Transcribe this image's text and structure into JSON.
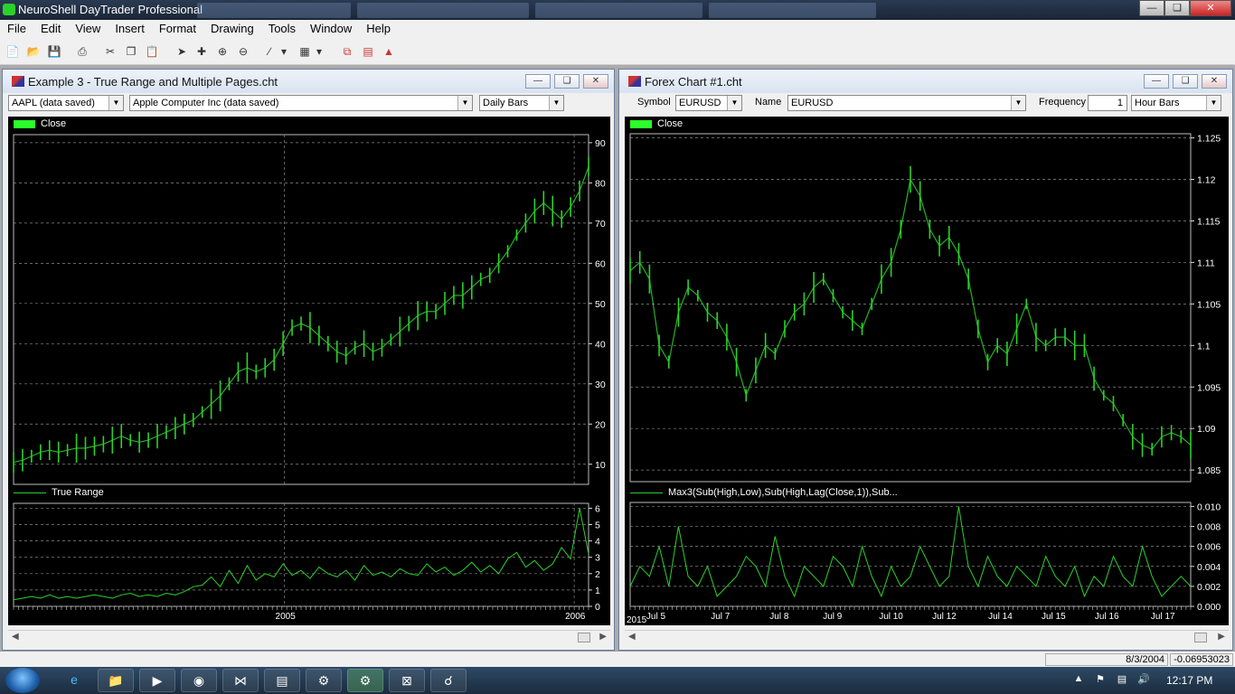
{
  "app": {
    "title": "NeuroShell DayTrader Professional"
  },
  "menu": [
    "File",
    "Edit",
    "View",
    "Insert",
    "Format",
    "Drawing",
    "Tools",
    "Window",
    "Help"
  ],
  "toolbar_icons": [
    "new-icon",
    "open-icon",
    "save-icon",
    "print-icon",
    "cut-icon",
    "copy-icon",
    "paste-icon",
    "pointer-icon",
    "crosshair-icon",
    "zoom-in-icon",
    "zoom-out-icon",
    "line-tool-icon",
    "fill-tool-icon",
    "cascade-windows-icon",
    "tile-windows-icon",
    "indicator-icon"
  ],
  "left": {
    "title": "Example 3 - True Range and Multiple Pages.cht",
    "symbol": "AAPL (data saved)",
    "name": "Apple Computer Inc (data saved)",
    "frequency": "Daily Bars",
    "legend_top": "Close",
    "legend_bottom": "True Range"
  },
  "right": {
    "title": "Forex Chart #1.cht",
    "symbol_label": "Symbol",
    "symbol": "EURUSD",
    "name_label": "Name",
    "name": "EURUSD",
    "frequency_label": "Frequency",
    "frequency_value": "1",
    "frequency": "Hour Bars",
    "legend_top": "Close",
    "legend_bottom": "Max3(Sub(High,Low),Sub(High,Lag(Close,1)),Sub..."
  },
  "status": {
    "date": "8/3/2004",
    "value": "-0.06953023"
  },
  "clock": "12:17 PM",
  "colors": {
    "series": "#2bd12b",
    "plot_bg": "#000000",
    "grid": "#8a8a8a"
  },
  "chart_data": [
    {
      "type": "bar",
      "title": "AAPL Close",
      "legend": "Close",
      "ylim": [
        5,
        92
      ],
      "yticks": [
        10,
        20,
        30,
        40,
        50,
        60,
        70,
        80,
        90
      ],
      "xticks": [
        "2005",
        "2006"
      ],
      "x": [
        0,
        10,
        20,
        30,
        40,
        50,
        60,
        70,
        80,
        90,
        100,
        110,
        120,
        130,
        140,
        150,
        160,
        170,
        180,
        190,
        200,
        210,
        220,
        230,
        240,
        250,
        260,
        270,
        280,
        290,
        300,
        310,
        320,
        330,
        340,
        350,
        360,
        370,
        380,
        390,
        400,
        410,
        420,
        430,
        440,
        450,
        460,
        470,
        480,
        490,
        500,
        510,
        520,
        530,
        540,
        550,
        560,
        570,
        580,
        590,
        600,
        610,
        620,
        630,
        640
      ],
      "values": [
        10.5,
        11,
        12,
        13,
        13.5,
        13,
        13.5,
        14,
        14,
        14.5,
        15,
        16,
        17,
        16,
        15.5,
        16,
        17,
        18,
        19,
        20,
        21,
        23,
        25,
        27,
        30,
        33,
        34,
        33,
        34,
        36,
        40,
        44,
        45,
        44,
        42,
        40,
        38,
        37,
        39,
        40,
        38,
        39,
        41,
        43,
        45,
        47,
        48,
        48,
        50,
        52,
        52,
        54,
        56,
        57,
        60,
        63,
        67,
        70,
        73,
        75,
        73,
        71,
        74,
        78,
        84
      ]
    },
    {
      "type": "line",
      "title": "True Range",
      "legend": "True Range",
      "ylim": [
        0,
        6.3
      ],
      "yticks": [
        0,
        1,
        2,
        3,
        4,
        5,
        6
      ],
      "values": [
        0.4,
        0.5,
        0.6,
        0.5,
        0.7,
        0.5,
        0.6,
        0.5,
        0.6,
        0.7,
        0.6,
        0.5,
        0.7,
        0.8,
        0.6,
        0.7,
        0.6,
        0.8,
        0.7,
        0.9,
        1.2,
        1.3,
        1.8,
        1.2,
        2.2,
        1.4,
        2.5,
        1.6,
        2.0,
        1.8,
        2.6,
        1.9,
        2.2,
        1.7,
        2.4,
        2.0,
        1.8,
        2.2,
        1.6,
        2.5,
        1.9,
        2.1,
        1.8,
        2.3,
        2.0,
        1.9,
        2.6,
        2.1,
        2.4,
        1.9,
        2.2,
        2.7,
        2.1,
        2.5,
        2.0,
        2.9,
        3.3,
        2.4,
        2.8,
        2.2,
        2.6,
        3.6,
        2.9,
        6.0,
        3.2
      ]
    },
    {
      "type": "bar",
      "title": "EURUSD Close",
      "legend": "Close",
      "ylim": [
        1.0836,
        1.1255
      ],
      "yticks": [
        1.085,
        1.09,
        1.095,
        1.1,
        1.105,
        1.11,
        1.115,
        1.12,
        1.125
      ],
      "xticks": [
        "Jul 5",
        "Jul 7",
        "Jul 8",
        "Jul 9",
        "Jul 10",
        "Jul 12",
        "Jul 14",
        "Jul 15",
        "Jul 16",
        "Jul 17"
      ],
      "corner_label": "2015",
      "values": [
        1.109,
        1.11,
        1.108,
        1.1,
        1.098,
        1.104,
        1.107,
        1.106,
        1.104,
        1.103,
        1.101,
        1.098,
        1.094,
        1.097,
        1.1,
        1.099,
        1.102,
        1.104,
        1.105,
        1.107,
        1.108,
        1.106,
        1.104,
        1.103,
        1.102,
        1.105,
        1.108,
        1.11,
        1.114,
        1.12,
        1.118,
        1.114,
        1.112,
        1.113,
        1.111,
        1.108,
        1.102,
        1.098,
        1.1,
        1.099,
        1.102,
        1.105,
        1.101,
        1.1,
        1.101,
        1.101,
        1.1,
        1.1,
        1.096,
        1.094,
        1.093,
        1.091,
        1.089,
        1.088,
        1.0875,
        1.089,
        1.0895,
        1.089,
        1.088
      ]
    },
    {
      "type": "line",
      "title": "Max3(Sub(High,Low),Sub(High,Lag(Close,1)),Sub...",
      "legend": "Max3(Sub(High,Low),Sub(High,Lag(Close,1)),Sub...",
      "ylim": [
        0,
        0.0104
      ],
      "yticks": [
        "0.000",
        "0.002",
        "0.004",
        "0.006",
        "0.008",
        "0.010"
      ],
      "values": [
        0.002,
        0.004,
        0.003,
        0.006,
        0.002,
        0.008,
        0.003,
        0.002,
        0.004,
        0.001,
        0.002,
        0.003,
        0.005,
        0.004,
        0.002,
        0.007,
        0.003,
        0.001,
        0.004,
        0.003,
        0.002,
        0.005,
        0.004,
        0.002,
        0.006,
        0.003,
        0.001,
        0.004,
        0.002,
        0.003,
        0.006,
        0.004,
        0.002,
        0.003,
        0.01,
        0.004,
        0.002,
        0.005,
        0.003,
        0.002,
        0.004,
        0.003,
        0.002,
        0.005,
        0.003,
        0.002,
        0.004,
        0.001,
        0.003,
        0.002,
        0.005,
        0.003,
        0.002,
        0.006,
        0.003,
        0.001,
        0.002,
        0.003,
        0.002
      ]
    }
  ]
}
